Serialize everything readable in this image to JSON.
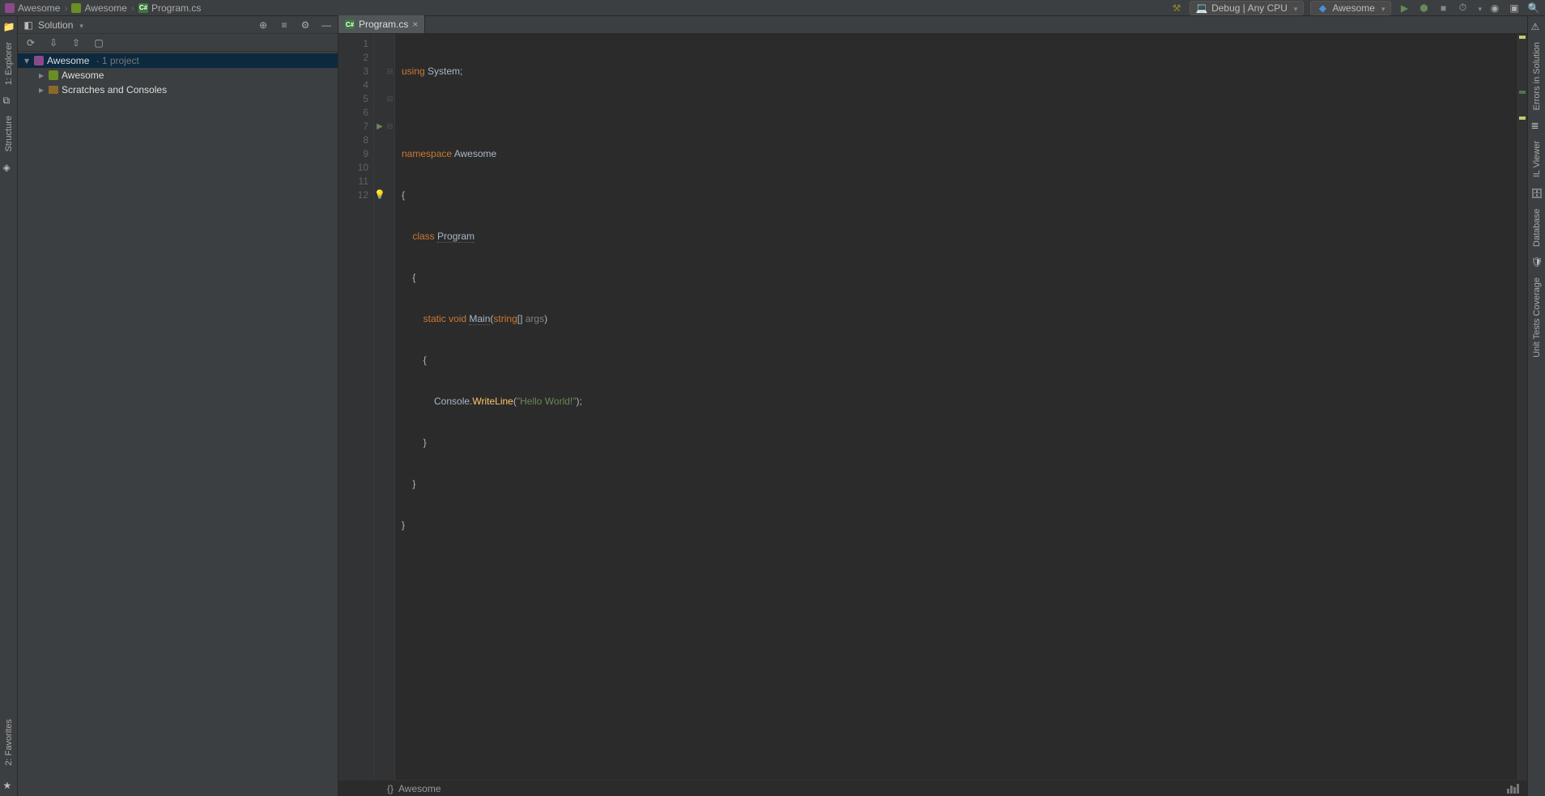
{
  "breadcrumb": [
    "Awesome",
    "Awesome",
    "Program.cs"
  ],
  "toolbar": {
    "config": "Debug | Any CPU",
    "run_target": "Awesome"
  },
  "sidebar": {
    "title": "Solution",
    "tree": {
      "root": {
        "label": "Awesome",
        "meta": "· 1 project"
      },
      "project": {
        "label": "Awesome"
      },
      "scratches": {
        "label": "Scratches and Consoles"
      }
    }
  },
  "left_tabs": {
    "explorer": "1: Explorer",
    "structure": "Structure",
    "favorites": "2: Favorites"
  },
  "right_tabs": {
    "errors": "Errors in Solution",
    "il": "IL Viewer",
    "db": "Database",
    "tests": "Unit Tests Coverage"
  },
  "editor": {
    "tab": "Program.cs",
    "breadcrumb_bottom": "Awesome",
    "code": {
      "l1_using": "using",
      "l1_sys": "System",
      "l1_semi": ";",
      "l3_ns": "namespace",
      "l3_name": "Awesome",
      "l4": "{",
      "l5_class": "class",
      "l5_name": "Program",
      "l6": "{",
      "l7_static": "static",
      "l7_void": "void",
      "l7_main": "Main",
      "l7_open": "(",
      "l7_string": "string",
      "l7_brack": "[]",
      "l7_args": " args",
      "l7_close": ")",
      "l8": "{",
      "l9_console": "Console",
      "l9_dot": ".",
      "l9_write": "WriteLine",
      "l9_open": "(",
      "l9_str": "\"Hello World!\"",
      "l9_close": ");",
      "l10": "}",
      "l11": "}",
      "l12": "}"
    },
    "line_numbers": [
      "1",
      "2",
      "3",
      "4",
      "5",
      "6",
      "7",
      "8",
      "9",
      "10",
      "11",
      "12"
    ]
  }
}
